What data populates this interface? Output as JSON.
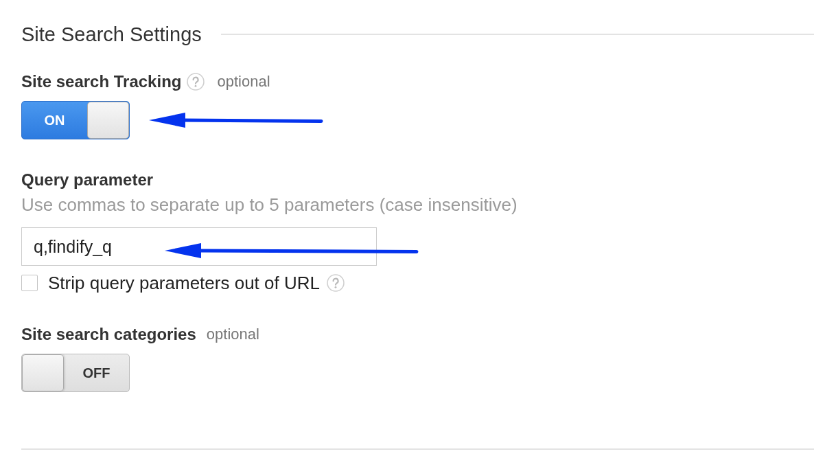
{
  "section_title": "Site Search Settings",
  "settings": [
    {
      "kind": "toggle",
      "label": "Site search Tracking",
      "help_icon": true,
      "note": "optional",
      "toggle": {
        "on": true,
        "text": "ON"
      },
      "arrow": true
    },
    {
      "kind": "text_field",
      "label": "Query parameter",
      "hint": "Use commas to separate up to 5 parameters (case insensitive)",
      "value": "q,findify_q",
      "arrow": true,
      "checkbox": {
        "label": "Strip query parameters out of URL",
        "checked": false,
        "help_icon": true
      }
    },
    {
      "kind": "toggle",
      "label": "Site search categories",
      "note": "optional",
      "toggle": {
        "on": false,
        "text": "OFF"
      }
    }
  ]
}
